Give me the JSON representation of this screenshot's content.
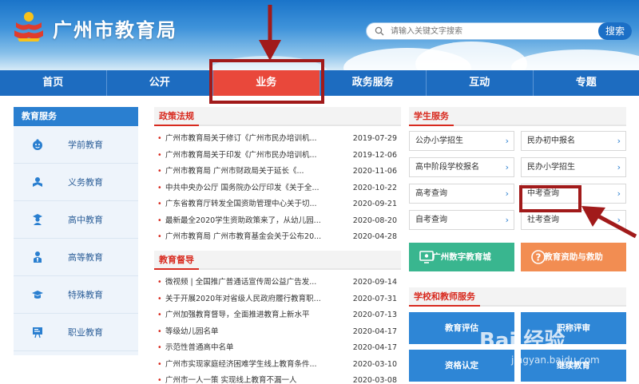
{
  "header": {
    "site_title": "广州市教育局",
    "search_placeholder": "请输入关键文字搜索",
    "search_button": "搜索"
  },
  "nav": [
    {
      "label": "首页"
    },
    {
      "label": "公开"
    },
    {
      "label": "业务"
    },
    {
      "label": "政务服务"
    },
    {
      "label": "互动"
    },
    {
      "label": "专题"
    }
  ],
  "sidebar": {
    "title": "教育服务",
    "items": [
      {
        "label": "学前教育",
        "icon": "child-face-icon"
      },
      {
        "label": "义务教育",
        "icon": "reading-student-icon"
      },
      {
        "label": "高中教育",
        "icon": "student-cap-icon"
      },
      {
        "label": "高等教育",
        "icon": "graduate-icon"
      },
      {
        "label": "特殊教育",
        "icon": "mortarboard-icon"
      },
      {
        "label": "职业教育",
        "icon": "presentation-icon"
      }
    ]
  },
  "policy": {
    "title": "政策法规",
    "items": [
      {
        "text": "广州市教育局关于修订《广州市民办培训机...",
        "date": "2019-07-29"
      },
      {
        "text": "广州市教育局关于印发《广州市民办培训机...",
        "date": "2019-12-06"
      },
      {
        "text": "广州市教育局 广州市财政局关于延长《...",
        "date": "2020-11-06"
      },
      {
        "text": "中共中央办公厅 国务院办公厅印发《关于全...",
        "date": "2020-10-22"
      },
      {
        "text": "广东省教育厅转发全国资助管理中心关于切...",
        "date": "2020-09-21"
      },
      {
        "text": "最新最全2020学生资助政策来了，从幼儿园...",
        "date": "2020-08-20"
      },
      {
        "text": "广州市教育局 广州市教育基金会关于公布20...",
        "date": "2020-04-28"
      }
    ]
  },
  "supervision": {
    "title": "教育督导",
    "items": [
      {
        "text": "微视频 | 全国推广普通话宣传周公益广告发...",
        "date": "2020-09-14"
      },
      {
        "text": "关于开展2020年对省级人民政府履行教育职...",
        "date": "2020-07-31"
      },
      {
        "text": "广州加强教育督导，全面推进教育上新水平",
        "date": "2020-07-13"
      },
      {
        "text": "等级幼儿园名单",
        "date": "2020-04-17"
      },
      {
        "text": "示范性普通高中名单",
        "date": "2020-04-17"
      },
      {
        "text": "广州市实现家庭经济困难学生线上教育条件...",
        "date": "2020-03-10"
      },
      {
        "text": "广州市一人一策 实现线上教育不漏一人",
        "date": "2020-03-08"
      }
    ]
  },
  "student_services": {
    "title": "学生服务",
    "items": [
      {
        "label": "公办小学招生"
      },
      {
        "label": "民办初中报名"
      },
      {
        "label": "高中阶段学校报名"
      },
      {
        "label": "民办小学招生"
      },
      {
        "label": "高考查询"
      },
      {
        "label": "中考查询"
      },
      {
        "label": "自考查询"
      },
      {
        "label": "社考查询"
      }
    ],
    "chevron": "›",
    "digital_city": "广州数字教育城",
    "aid": "教育资助与救助"
  },
  "school_teacher": {
    "title": "学校和教师服务",
    "items": [
      {
        "label": "教育评估"
      },
      {
        "label": "职称评审"
      },
      {
        "label": "资格认定"
      },
      {
        "label": "继续教育"
      }
    ]
  },
  "watermark": {
    "text": "Bai 经验",
    "url": "jingyan.baidu.com"
  },
  "colors": {
    "brand_blue": "#1d6cc0",
    "active_red": "#e9483b",
    "section_red": "#d82a1f",
    "green": "#39b68f",
    "orange": "#f28d52",
    "highlight": "#a11a1a"
  }
}
